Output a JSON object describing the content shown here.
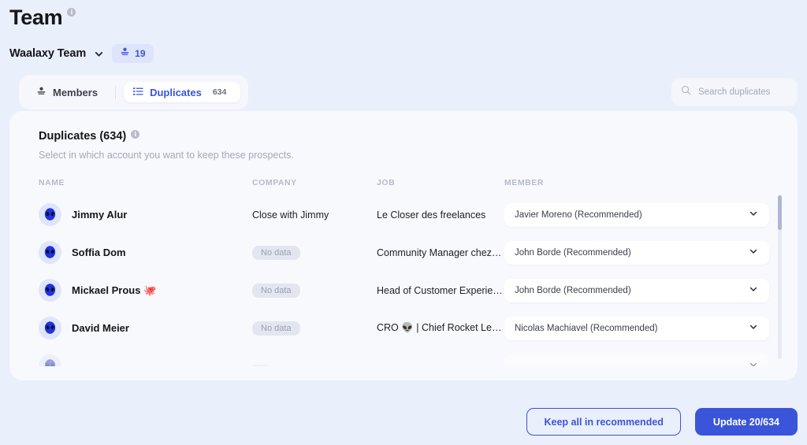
{
  "header": {
    "title": "Team",
    "info_icon": "info-icon",
    "team_name": "Waalaxy Team",
    "team_dropdown_icon": "chevron-down-icon",
    "members_count": "19",
    "members_count_icon": "people-icon"
  },
  "tabs": [
    {
      "label": "Members",
      "icon": "people-icon",
      "active": false,
      "badge": ""
    },
    {
      "label": "Duplicates",
      "icon": "list-icon",
      "active": true,
      "badge": "634"
    }
  ],
  "search": {
    "placeholder": "Search duplicates",
    "value": "",
    "icon": "search-icon"
  },
  "card": {
    "title": "Duplicates (634)",
    "info_icon": "info-icon",
    "subtitle": "Select in which account you want to keep these prospects."
  },
  "table": {
    "columns": [
      "NAME",
      "COMPANY",
      "JOB",
      "MEMBER"
    ],
    "rows": [
      {
        "avatar": "alien-avatar",
        "name": "Jimmy Alur",
        "company": "Close with Jimmy",
        "company_empty": false,
        "job": "Le Closer des freelances",
        "member": "Javier Moreno (Recommended)"
      },
      {
        "avatar": "alien-avatar",
        "name": "Soffia Dom",
        "company": "No data",
        "company_empty": true,
        "job": "Community Manager chez…",
        "member": "John Borde (Recommended)"
      },
      {
        "avatar": "alien-avatar",
        "name": "Mickael Prous 🐙",
        "company": "No data",
        "company_empty": true,
        "job": "Head of Customer Experie…",
        "member": "John Borde (Recommended)"
      },
      {
        "avatar": "alien-avatar",
        "name": "David Meier",
        "company": "No data",
        "company_empty": true,
        "job": "CRO 👽 | Chief Rocket Le…",
        "member": "Nicolas Machiavel (Recommended)"
      },
      {
        "avatar": "alien-avatar",
        "name": "",
        "company": "",
        "company_empty": true,
        "job": "",
        "member": ""
      }
    ],
    "scrollbar": "vertical-scrollbar"
  },
  "footer": {
    "keep_all_label": "Keep all in recommended",
    "update_label": "Update 20/634"
  },
  "colors": {
    "page_bg": "#eaeffc",
    "card_bg": "#f8f9fd",
    "accent": "#3a55d9",
    "muted_text": "#a3a7b8",
    "badge_bg": "#dde4fb",
    "nodata_bg": "#e3e6f0"
  }
}
